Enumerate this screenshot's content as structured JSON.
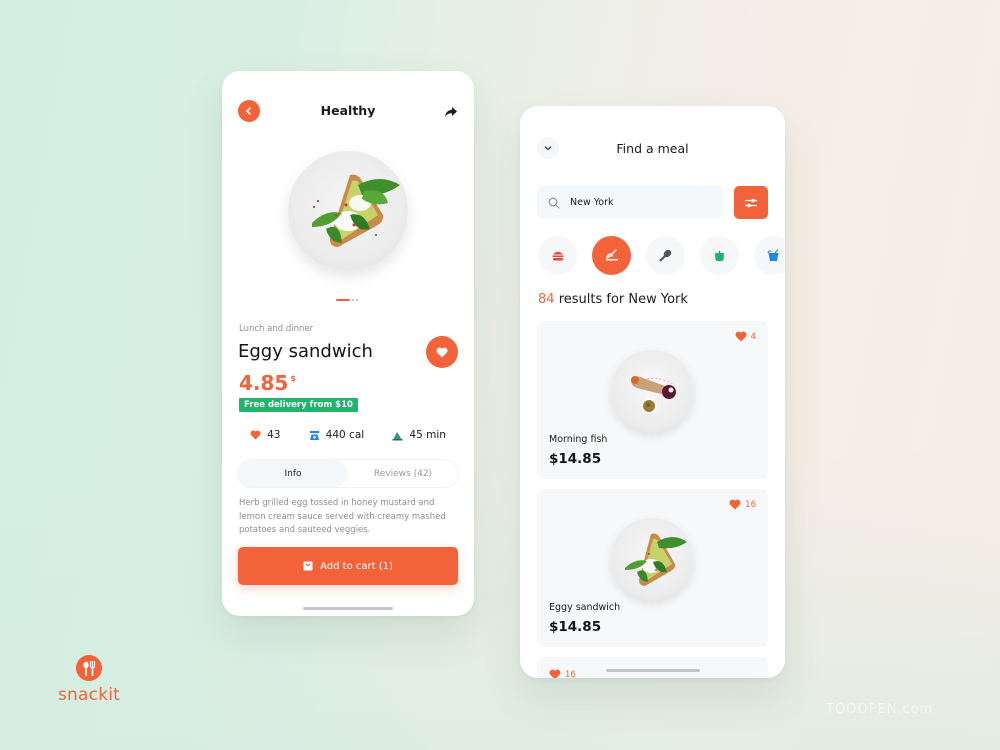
{
  "brand": {
    "name": "snackit",
    "accent": "#f4623a",
    "success": "#21b46c"
  },
  "detail_screen": {
    "header": {
      "title": "Healthy",
      "back_icon": "chevron-left-icon",
      "share_icon": "share-icon"
    },
    "carousel": {
      "total_slides": 3,
      "active_slide": 1
    },
    "category": "Lunch and dinner",
    "title": "Eggy sandwich",
    "price": "4.85",
    "price_currency": "$",
    "delivery_badge": "Free delivery from $10",
    "stats": [
      {
        "icon": "heart-icon",
        "value": "43"
      },
      {
        "icon": "scale-icon",
        "value": "440 cal"
      },
      {
        "icon": "cooking-time-icon",
        "value": "45 min"
      }
    ],
    "tabs": [
      {
        "label": "Info",
        "active": true
      },
      {
        "label": "Reviews (42)",
        "active": false
      }
    ],
    "description": "Herb grilled egg tossed in honey mustard and lemon cream sauce served with creamy mashed potatoes and sauteed veggies.",
    "cart_button": "Add to cart (1)"
  },
  "search_screen": {
    "header": {
      "title": "Find a meal",
      "collapse_icon": "chevron-down-icon"
    },
    "search": {
      "value": "New York",
      "placeholder": "Search"
    },
    "categories": [
      {
        "name": "burger",
        "icon": "burger-icon",
        "color": "#e8453c",
        "active": false
      },
      {
        "name": "hot-meals",
        "icon": "cooking-icon",
        "color": "#ffffff",
        "active": true
      },
      {
        "name": "meat",
        "icon": "drumstick-icon",
        "color": "#555555",
        "active": false
      },
      {
        "name": "vegetables",
        "icon": "pepper-icon",
        "color": "#21b46c",
        "active": false
      },
      {
        "name": "drinks",
        "icon": "drink-icon",
        "color": "#1e88e5",
        "active": false
      }
    ],
    "results": {
      "count": "84",
      "text": "results for New York"
    },
    "meals": [
      {
        "name": "Morning fish",
        "price": "$14.85",
        "likes": "4"
      },
      {
        "name": "Eggy sandwich",
        "price": "$14.85",
        "likes": "16"
      },
      {
        "name": "",
        "price": "",
        "likes": "16"
      }
    ]
  },
  "watermark": "TOOOPEN.com"
}
